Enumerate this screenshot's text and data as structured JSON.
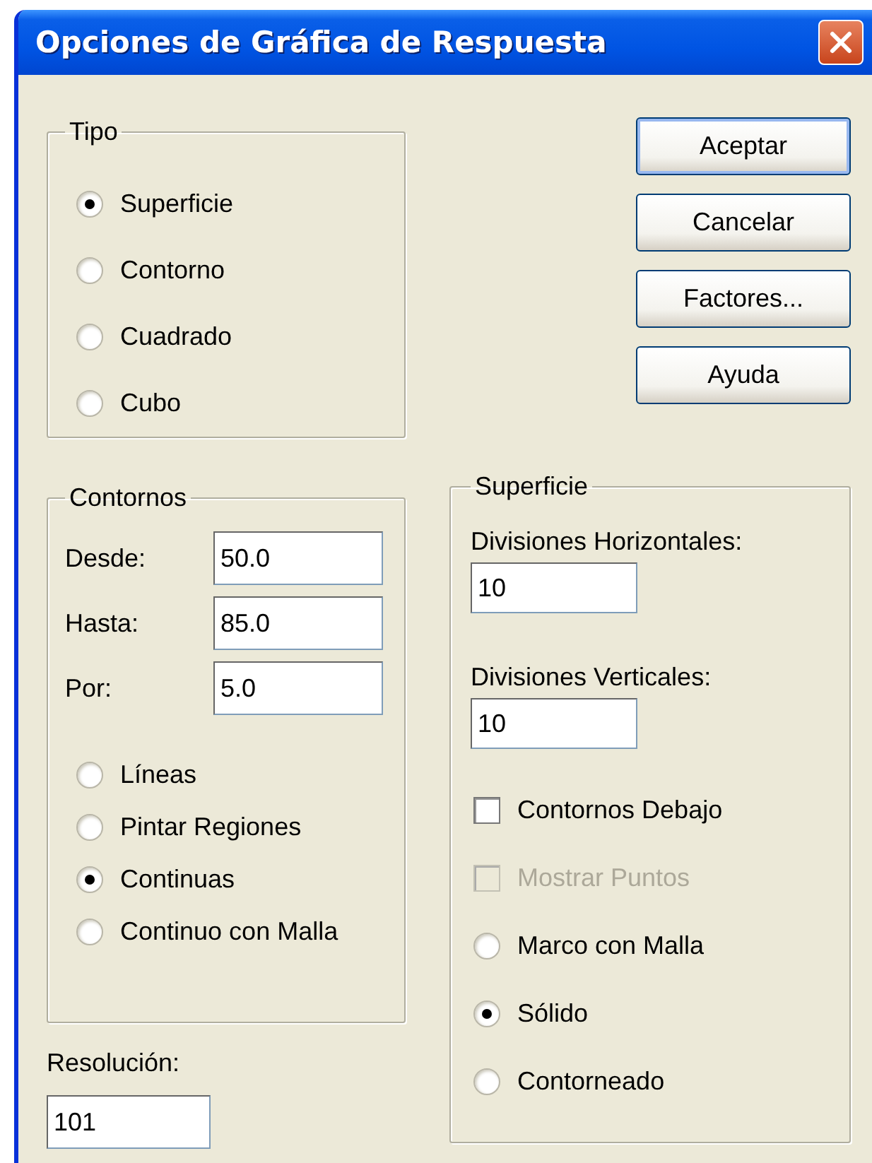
{
  "window": {
    "title": "Opciones de Gráfica de Respuesta"
  },
  "tipo": {
    "label": "Tipo",
    "options": [
      {
        "label": "Superficie",
        "selected": true
      },
      {
        "label": "Contorno",
        "selected": false
      },
      {
        "label": "Cuadrado",
        "selected": false
      },
      {
        "label": "Cubo",
        "selected": false
      }
    ]
  },
  "contornos": {
    "label": "Contornos",
    "fields": [
      {
        "label": "Desde:",
        "value": "50.0"
      },
      {
        "label": "Hasta:",
        "value": "85.0"
      },
      {
        "label": "Por:",
        "value": "5.0"
      }
    ],
    "options": [
      {
        "label": "Líneas",
        "selected": false
      },
      {
        "label": "Pintar Regiones",
        "selected": false
      },
      {
        "label": "Continuas",
        "selected": true
      },
      {
        "label": "Continuo con Malla",
        "selected": false
      }
    ]
  },
  "resolucion": {
    "label": "Resolución:",
    "value": "101"
  },
  "buttons": [
    "Aceptar",
    "Cancelar",
    "Factores...",
    "Ayuda"
  ],
  "superficie": {
    "label": "Superficie",
    "fields": [
      {
        "label": "Divisiones Horizontales:",
        "value": "10"
      },
      {
        "label": "Divisiones Verticales:",
        "value": "10"
      }
    ],
    "items": [
      {
        "kind": "checkbox",
        "label": "Contornos Debajo",
        "checked": false,
        "disabled": false
      },
      {
        "kind": "checkbox",
        "label": "Mostrar Puntos",
        "checked": false,
        "disabled": true
      },
      {
        "kind": "radio",
        "label": "Marco con Malla",
        "selected": false,
        "disabled": false
      },
      {
        "kind": "radio",
        "label": "Sólido",
        "selected": true,
        "disabled": false
      },
      {
        "kind": "radio",
        "label": "Contorneado",
        "selected": false,
        "disabled": false
      }
    ]
  }
}
